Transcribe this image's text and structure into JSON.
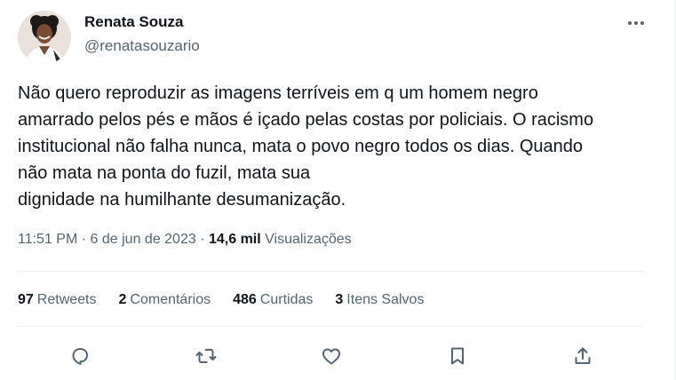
{
  "author": {
    "name": "Renata Souza",
    "handle": "@renatasouzario"
  },
  "tweet": {
    "lines": [
      "Não quero reproduzir as imagens terríveis em q um homem negro",
      "amarrado pelos pés e mãos é içado pelas costas por policiais. O racismo",
      "institucional não falha nunca, mata o povo negro todos os dias. Quando",
      "não mata na ponta do fuzil, mata sua",
      "dignidade na humilhante desumanização."
    ],
    "time": "11:51 PM",
    "separator": "·",
    "date": "6 de jun de 2023",
    "views_count": "14,6 mil",
    "views_label": "Visualizações"
  },
  "stats": [
    {
      "count": "97",
      "label": "Retweets"
    },
    {
      "count": "2",
      "label": "Comentários"
    },
    {
      "count": "486",
      "label": "Curtidas"
    },
    {
      "count": "3",
      "label": "Itens Salvos"
    }
  ],
  "actions": {
    "icons": [
      "reply-icon",
      "retweet-icon",
      "like-icon",
      "bookmark-icon",
      "share-icon"
    ]
  },
  "colors": {
    "text_primary": "#0f1419",
    "text_secondary": "#536471",
    "divider": "#eff3f4"
  }
}
